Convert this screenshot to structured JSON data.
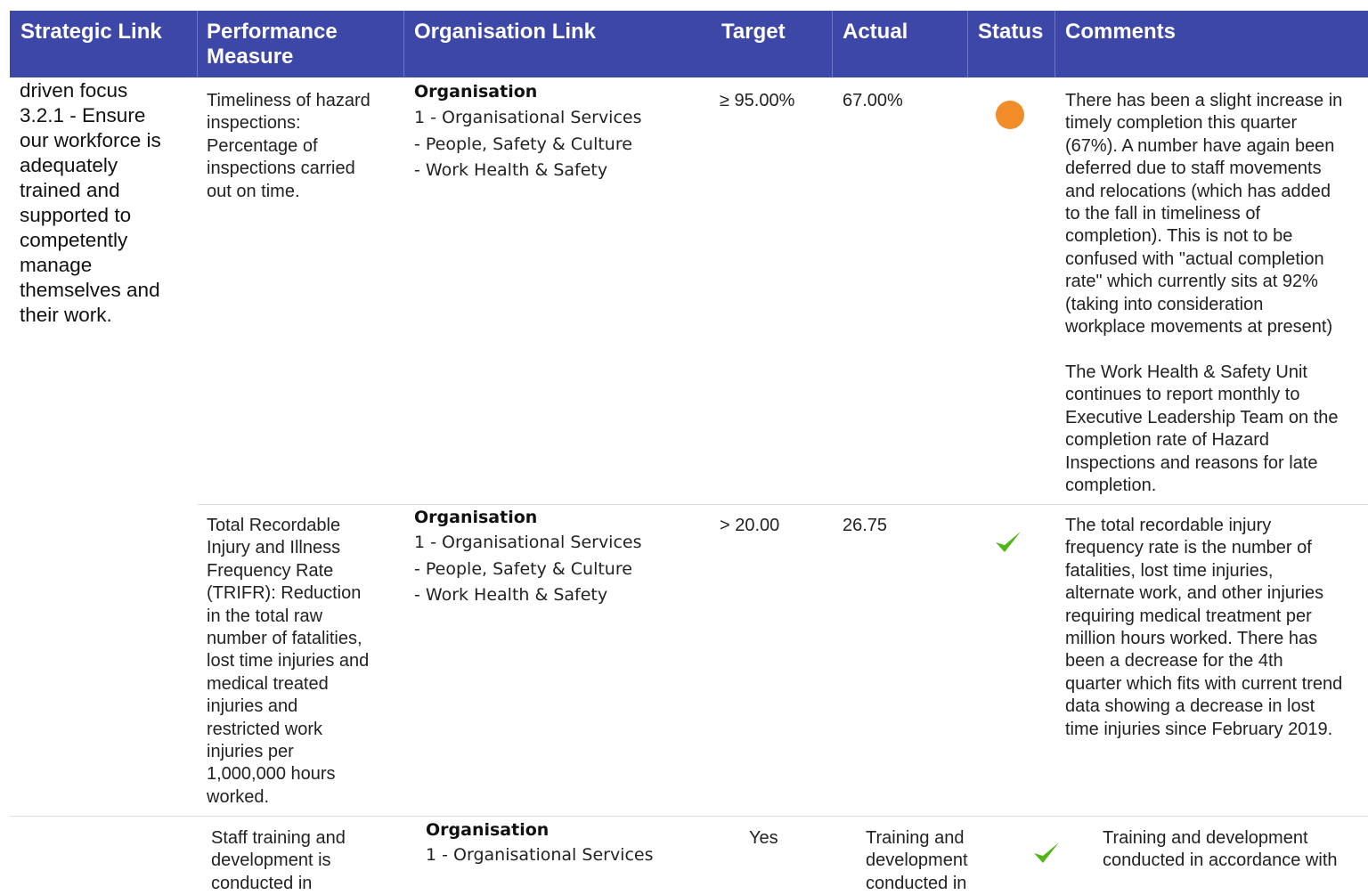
{
  "headers": {
    "strategic_link": "Strategic Link",
    "performance_measure": "Performance\nMeasure",
    "organisation_link": "Organisation Link",
    "target": "Target",
    "actual": "Actual",
    "status": "Status",
    "comments": "Comments"
  },
  "strategic": {
    "line1": "driven focus",
    "link": "3.2.1 - Ensure\nour workforce is\nadequately\ntrained and\nsupported to\ncompetently\nmanage\nthemselves and\ntheir work."
  },
  "rows": [
    {
      "measure": "Timeliness of hazard\ninspections:\nPercentage of\ninspections carried\nout on time.",
      "org_heading": "Organisation",
      "org_1": "1 - Organisational Services",
      "org_2": "- People, Safety & Culture",
      "org_3": "- Work Health & Safety",
      "target": "≥ 95.00%",
      "actual": "67.00%",
      "status": "amber-dot-icon",
      "comment": "There has been a slight increase in\ntimely completion this quarter\n(67%). A number have again been\ndeferred due to staff movements\nand relocations (which has added\nto the fall in timeliness of\ncompletion). This is not to be\nconfused with \"actual completion\nrate\" which currently sits at 92%\n(taking into consideration\nworkplace movements at present)\n\nThe Work Health & Safety Unit\ncontinues to report monthly to\nExecutive Leadership Team on the\ncompletion rate of Hazard\nInspections and reasons for late\ncompletion."
    },
    {
      "measure": "Total Recordable\nInjury and Illness\nFrequency Rate\n(TRIFR): Reduction\nin the total raw\nnumber of fatalities,\nlost time injuries and\nmedical treated\ninjuries and\nrestricted work\ninjuries per\n1,000,000 hours\nworked.",
      "org_heading": "Organisation",
      "org_1": "1 - Organisational Services",
      "org_2": "- People, Safety & Culture",
      "org_3": "- Work Health & Safety",
      "target": "> 20.00",
      "actual": "26.75",
      "status": "green-check-icon",
      "comment": "The total recordable injury\nfrequency rate is the number of\nfatalities, lost time injuries,\nalternate work, and other injuries\nrequiring medical treatment per\nmillion hours worked. There has\nbeen a decrease for the 4th\nquarter which fits with current trend\ndata showing a decrease in lost\ntime injuries since February 2019."
    },
    {
      "measure": "Staff training and\ndevelopment is\nconducted in",
      "org_heading": "Organisation",
      "org_1": "1 - Organisational Services",
      "target": "Yes",
      "actual": "Training and\ndevelopment\nconducted in",
      "status": "green-check-icon",
      "comment": "Training and development\nconducted in accordance with"
    }
  ],
  "colors": {
    "header_bg": "#3d47a8",
    "link_green": "#43a047",
    "status_amber": "#f28c28",
    "status_check": "#52b51a"
  }
}
